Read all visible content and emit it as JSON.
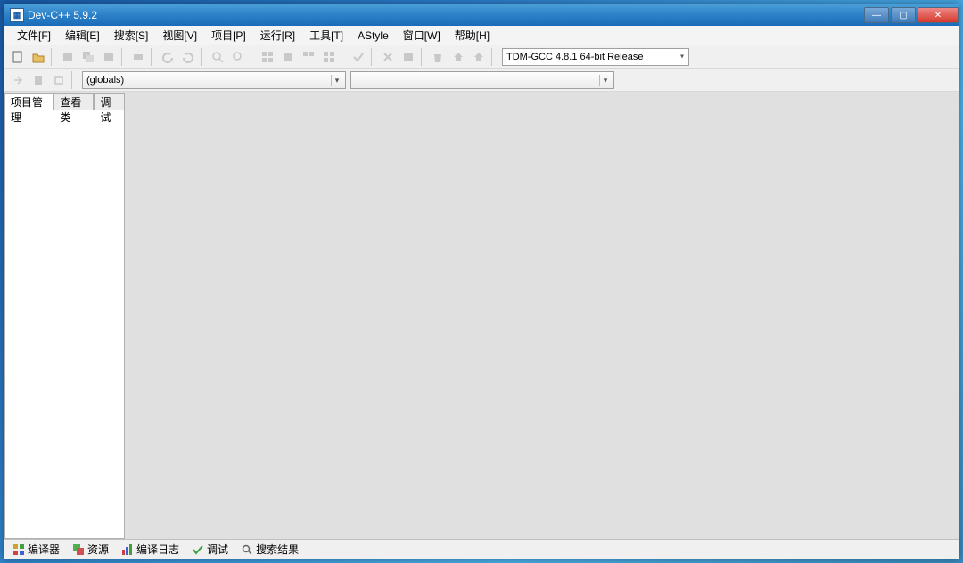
{
  "title": "Dev-C++ 5.9.2",
  "window_controls": {
    "min": "—",
    "max": "▢",
    "close": "✕"
  },
  "menubar": [
    {
      "label": "文件[F]"
    },
    {
      "label": "编辑[E]"
    },
    {
      "label": "搜索[S]"
    },
    {
      "label": "视图[V]"
    },
    {
      "label": "项目[P]"
    },
    {
      "label": "运行[R]"
    },
    {
      "label": "工具[T]"
    },
    {
      "label": "AStyle"
    },
    {
      "label": "窗口[W]"
    },
    {
      "label": "帮助[H]"
    }
  ],
  "toolbar": {
    "compiler_combo": "TDM-GCC 4.8.1 64-bit Release"
  },
  "scope_combo": "(globals)",
  "member_combo": "",
  "left_tabs": [
    {
      "label": "项目管理",
      "active": true
    },
    {
      "label": "查看类",
      "active": false
    },
    {
      "label": "调试",
      "active": false
    }
  ],
  "bottom_tabs": [
    {
      "icon": "grid",
      "label": "编译器"
    },
    {
      "icon": "copy",
      "label": "资源"
    },
    {
      "icon": "chart",
      "label": "编译日志"
    },
    {
      "icon": "check",
      "label": "调试"
    },
    {
      "icon": "search",
      "label": "搜索结果"
    }
  ]
}
